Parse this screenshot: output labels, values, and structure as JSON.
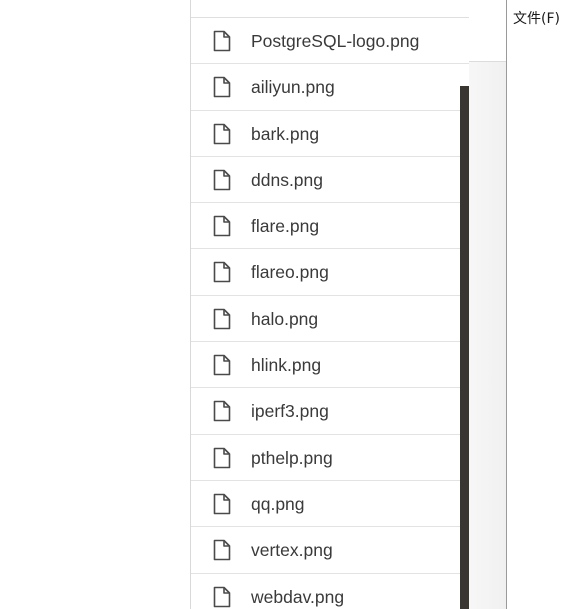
{
  "file_list": {
    "parent_glyph": "\"",
    "files": [
      {
        "name": "PostgreSQL-logo.png",
        "icon": "file-icon"
      },
      {
        "name": "ailiyun.png",
        "icon": "file-icon"
      },
      {
        "name": "bark.png",
        "icon": "file-icon"
      },
      {
        "name": "ddns.png",
        "icon": "file-icon"
      },
      {
        "name": "flare.png",
        "icon": "file-icon"
      },
      {
        "name": "flareo.png",
        "icon": "file-icon"
      },
      {
        "name": "halo.png",
        "icon": "file-icon"
      },
      {
        "name": "hlink.png",
        "icon": "file-icon"
      },
      {
        "name": "iperf3.png",
        "icon": "file-icon"
      },
      {
        "name": "pthelp.png",
        "icon": "file-icon"
      },
      {
        "name": "qq.png",
        "icon": "file-icon"
      },
      {
        "name": "vertex.png",
        "icon": "file-icon"
      },
      {
        "name": "webdav.png",
        "icon": "file-icon"
      }
    ]
  },
  "menu_bar": {
    "file_menu": "文件(F)"
  },
  "colors": {
    "accent": "#2f6fd6",
    "scrollbar": "#393632",
    "text": "#3a3a3a"
  }
}
